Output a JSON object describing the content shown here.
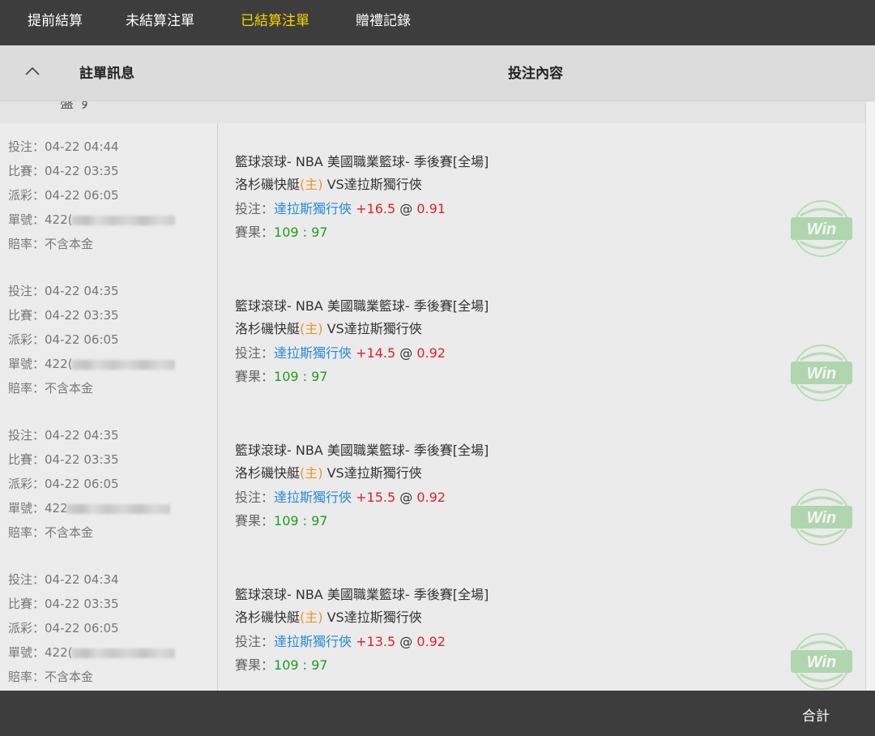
{
  "tabs": [
    {
      "label": "提前結算",
      "active": false
    },
    {
      "label": "未結算注單",
      "active": false
    },
    {
      "label": "已結算注單",
      "active": true
    },
    {
      "label": "贈禮記錄",
      "active": false
    }
  ],
  "header": {
    "col1": "註單訊息",
    "col2": "投注內容"
  },
  "subheader_partial": "盤 す",
  "left_labels": {
    "bet": "投注：",
    "match": "比賽：",
    "payout": "派彩：",
    "ticket": "單號：",
    "odds": "賠率："
  },
  "bets": [
    {
      "bet_time": "04-22 04:44",
      "match_time": "04-22 03:35",
      "payout_time": "04-22 06:05",
      "ticket_prefix": "422(",
      "odds_type": "不含本金",
      "league": "籃球滾球- NBA 美國職業籃球- 季後賽[全場]",
      "home": "洛杉磯快艇",
      "home_tag": "(主)",
      "vs_away": " VS達拉斯獨行俠",
      "pick_label": "投注：",
      "pick_team": "達拉斯獨行俠",
      "handicap": " +16.5",
      "at": " @ ",
      "odds": "0.91",
      "result_label": "賽果：",
      "score": "109 : 97",
      "status": "Win"
    },
    {
      "bet_time": "04-22 04:35",
      "match_time": "04-22 03:35",
      "payout_time": "04-22 06:05",
      "ticket_prefix": "422(",
      "odds_type": "不含本金",
      "league": "籃球滾球- NBA 美國職業籃球- 季後賽[全場]",
      "home": "洛杉磯快艇",
      "home_tag": "(主)",
      "vs_away": " VS達拉斯獨行俠",
      "pick_label": "投注：",
      "pick_team": "達拉斯獨行俠",
      "handicap": " +14.5",
      "at": " @ ",
      "odds": "0.92",
      "result_label": "賽果：",
      "score": "109 : 97",
      "status": "Win"
    },
    {
      "bet_time": "04-22 04:35",
      "match_time": "04-22 03:35",
      "payout_time": "04-22 06:05",
      "ticket_prefix": "422",
      "odds_type": "不含本金",
      "league": "籃球滾球- NBA 美國職業籃球- 季後賽[全場]",
      "home": "洛杉磯快艇",
      "home_tag": "(主)",
      "vs_away": " VS達拉斯獨行俠",
      "pick_label": "投注：",
      "pick_team": "達拉斯獨行俠",
      "handicap": " +15.5",
      "at": " @ ",
      "odds": "0.92",
      "result_label": "賽果：",
      "score": "109 : 97",
      "status": "Win"
    },
    {
      "bet_time": "04-22 04:34",
      "match_time": "04-22 03:35",
      "payout_time": "04-22 06:05",
      "ticket_prefix": "422(",
      "odds_type": "不含本金",
      "league": "籃球滾球- NBA 美國職業籃球- 季後賽[全場]",
      "home": "洛杉磯快艇",
      "home_tag": "(主)",
      "vs_away": " VS達拉斯獨行俠",
      "pick_label": "投注：",
      "pick_team": "達拉斯獨行俠",
      "handicap": " +13.5",
      "at": " @ ",
      "odds": "0.92",
      "result_label": "賽果：",
      "score": "109 : 97",
      "status": "Win"
    }
  ],
  "footer": {
    "total_label": "合計"
  },
  "colors": {
    "nav_bg": "#3d3d3d",
    "active_tab": "#f5d500",
    "home_tag": "#f0951e",
    "team": "#2a8ad6",
    "handicap": "#e02222",
    "score": "#1e9d1e",
    "win_badge": "#8fd08f"
  }
}
